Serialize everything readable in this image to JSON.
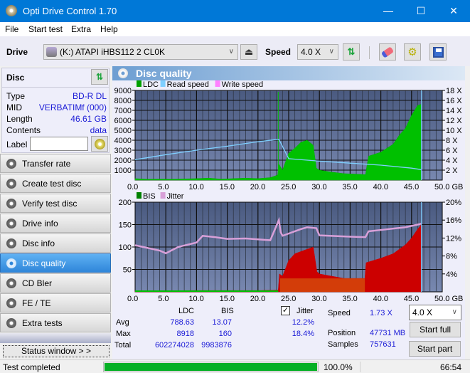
{
  "window": {
    "title": "Opti Drive Control 1.70",
    "minimize": "—",
    "maximize": "☐",
    "close": "✕"
  },
  "menu": [
    "File",
    "Start test",
    "Extra",
    "Help"
  ],
  "toolbar": {
    "drive_label": "Drive",
    "drive_value": "(K:)  ATAPI iHBS112  2 CL0K",
    "speed_label": "Speed",
    "speed_value": "4.0 X"
  },
  "disc": {
    "header": "Disc",
    "fields": [
      {
        "label": "Type",
        "value": "BD-R DL"
      },
      {
        "label": "MID",
        "value": "VERBATIMf (000)"
      },
      {
        "label": "Length",
        "value": "46.61 GB"
      },
      {
        "label": "Contents",
        "value": "data"
      }
    ],
    "label_label": "Label",
    "label_value": ""
  },
  "nav": [
    {
      "label": "Transfer rate",
      "active": false
    },
    {
      "label": "Create test disc",
      "active": false
    },
    {
      "label": "Verify test disc",
      "active": false
    },
    {
      "label": "Drive info",
      "active": false
    },
    {
      "label": "Disc info",
      "active": false
    },
    {
      "label": "Disc quality",
      "active": true
    },
    {
      "label": "CD Bler",
      "active": false
    },
    {
      "label": "FE / TE",
      "active": false
    },
    {
      "label": "Extra tests",
      "active": false
    }
  ],
  "status_window_label": "Status window > >",
  "main": {
    "title": "Disc quality"
  },
  "chart_data": [
    {
      "type": "area",
      "title": "LDC / Read speed",
      "legend": [
        {
          "name": "LDC",
          "color": "#00a000"
        },
        {
          "name": "Read speed",
          "color": "#7fd0ff"
        },
        {
          "name": "Write speed",
          "color": "#ff80ff"
        }
      ],
      "xlabel": "GB",
      "xlim": [
        0,
        50
      ],
      "xticks": [
        "0.0",
        "5.0",
        "10.0",
        "15.0",
        "20.0",
        "25.0",
        "30.0",
        "35.0",
        "40.0",
        "45.0",
        "50.0 GB"
      ],
      "ylim_left": [
        0,
        9000
      ],
      "yticks_left": [
        "9000",
        "8000",
        "7000",
        "6000",
        "5000",
        "4000",
        "3000",
        "2000",
        "1000"
      ],
      "ylim_right": [
        0,
        18
      ],
      "yticks_right": [
        "18 X",
        "16 X",
        "14 X",
        "12 X",
        "10 X",
        "8 X",
        "6 X",
        "4 X",
        "2 X"
      ],
      "series": [
        {
          "name": "LDC",
          "x": [
            0,
            2,
            4,
            6,
            8,
            10,
            12,
            14,
            16,
            18,
            20,
            22,
            23.2,
            23.4,
            24,
            25,
            26,
            27,
            28,
            29,
            29.5,
            30,
            32,
            34,
            36,
            37.5,
            38,
            40,
            42,
            43,
            44,
            45,
            46,
            46.6
          ],
          "values": [
            150,
            80,
            100,
            80,
            120,
            150,
            200,
            100,
            150,
            200,
            150,
            250,
            500,
            1600,
            1000,
            2700,
            3200,
            3800,
            4000,
            3500,
            1200,
            1000,
            800,
            650,
            600,
            550,
            2400,
            2800,
            3600,
            4500,
            5200,
            6500,
            7500,
            7600
          ]
        },
        {
          "name": "Read speed",
          "x": [
            0,
            5,
            10,
            15,
            20,
            23.4,
            25,
            30,
            35,
            40,
            45,
            46.6
          ],
          "values": [
            4.1,
            5.1,
            6.0,
            6.8,
            7.7,
            8.2,
            4.3,
            3.8,
            3.4,
            3.0,
            2.4,
            2.1
          ]
        }
      ]
    },
    {
      "type": "area",
      "title": "BIS / Jitter",
      "legend": [
        {
          "name": "BIS",
          "color": "#008000"
        },
        {
          "name": "Jitter",
          "color": "#d8a0d8"
        }
      ],
      "xlabel": "GB",
      "xlim": [
        0,
        50
      ],
      "xticks": [
        "0.0",
        "5.0",
        "10.0",
        "15.0",
        "20.0",
        "25.0",
        "30.0",
        "35.0",
        "40.0",
        "45.0",
        "50.0 GB"
      ],
      "ylim_left": [
        0,
        200
      ],
      "yticks_left": [
        "200",
        "150",
        "100",
        "50"
      ],
      "ylim_right": [
        0,
        20
      ],
      "yticks_right": [
        "20%",
        "16%",
        "12%",
        "8%",
        "4%"
      ],
      "series": [
        {
          "name": "BIS",
          "x": [
            0,
            10,
            20,
            23.3,
            23.5,
            24,
            25,
            26,
            27,
            28,
            29,
            29.6,
            30,
            32,
            34,
            36,
            37.4,
            37.6,
            40,
            42,
            44,
            45,
            46,
            46.6
          ],
          "values": [
            2,
            3,
            3,
            4,
            40,
            35,
            70,
            85,
            90,
            95,
            100,
            45,
            40,
            35,
            30,
            30,
            30,
            65,
            75,
            85,
            105,
            120,
            140,
            150
          ]
        },
        {
          "name": "Jitter",
          "x": [
            0,
            2,
            4,
            5,
            7,
            10,
            11,
            13,
            15,
            18,
            20,
            22,
            23.4,
            23.7,
            24,
            26,
            27,
            28,
            29.5,
            30,
            35,
            37.5,
            38,
            40,
            42,
            44,
            46,
            46.6
          ],
          "values": [
            10.4,
            9.8,
            9.2,
            8.6,
            10.0,
            11.0,
            12.5,
            12.2,
            11.8,
            11.9,
            11.7,
            11.5,
            16.0,
            13.3,
            12.5,
            13.5,
            14.0,
            14.4,
            14.2,
            12.6,
            12.3,
            12.2,
            13.5,
            13.8,
            14.1,
            14.4,
            15.0,
            15.2
          ]
        }
      ]
    }
  ],
  "stats": {
    "col_ldc": "LDC",
    "col_bis": "BIS",
    "jitter_label": "Jitter",
    "jitter_checked": true,
    "rows": [
      {
        "label": "Avg",
        "ldc": "788.63",
        "bis": "13.07",
        "jitter": "12.2%"
      },
      {
        "label": "Max",
        "ldc": "8918",
        "bis": "160",
        "jitter": "18.4%"
      },
      {
        "label": "Total",
        "ldc": "602274028",
        "bis": "9983876",
        "jitter": ""
      }
    ],
    "speed_label": "Speed",
    "speed_value": "1.73 X",
    "position_label": "Position",
    "position_value": "47731 MB",
    "samples_label": "Samples",
    "samples_value": "757631",
    "speed_select": "4.0 X",
    "start_full": "Start full",
    "start_part": "Start part"
  },
  "statusbar": {
    "text": "Test completed",
    "progress": 1.0,
    "progress_text": "100.0%",
    "time": "66:54",
    "progress_color": "#06b025"
  }
}
